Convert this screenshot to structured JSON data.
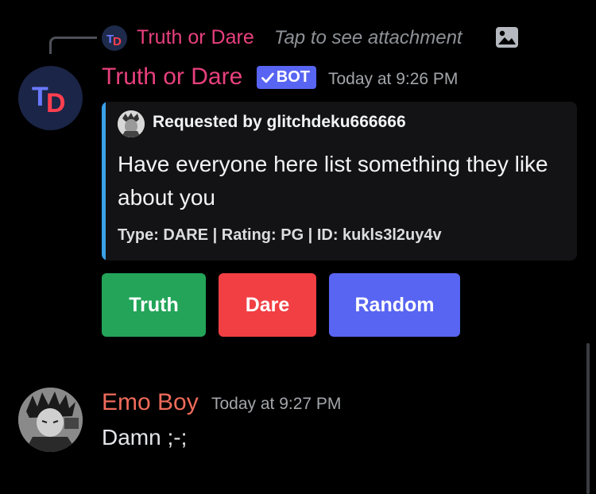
{
  "reply": {
    "author": "Truth or Dare",
    "hint": "Tap to see attachment"
  },
  "bot_message": {
    "author": "Truth or Dare",
    "bot_tag": "BOT",
    "timestamp": "Today at 9:26 PM",
    "embed": {
      "author": "Requested by glitchdeku666666",
      "description": "Have everyone here list something they like about you",
      "footer": "Type: DARE | Rating: PG | ID: kukls3l2uy4v",
      "accent_color": "#3aa0e8"
    },
    "buttons": [
      {
        "label": "Truth",
        "color": "#23a459"
      },
      {
        "label": "Dare",
        "color": "#f23f43"
      },
      {
        "label": "Random",
        "color": "#5865f2"
      }
    ]
  },
  "user_message": {
    "author": "Emo Boy",
    "timestamp": "Today at 9:27 PM",
    "text": "Damn ;-;"
  },
  "logo": {
    "letters": "TD",
    "colors": [
      "#6a79ff",
      "#ff3f4f"
    ]
  }
}
